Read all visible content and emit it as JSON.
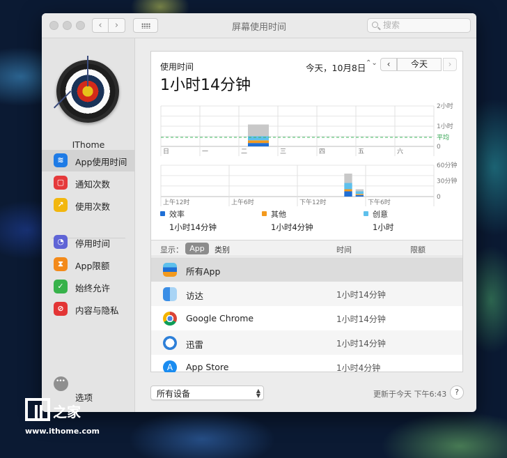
{
  "window": {
    "title": "屏幕使用时间",
    "search_placeholder": "搜索"
  },
  "sidebar": {
    "username": "IThome",
    "items": [
      {
        "label": "App使用时间",
        "icon": "layers-icon",
        "color": "#1e7be6",
        "active": true
      },
      {
        "label": "通知次数",
        "icon": "notification-icon",
        "color": "#e5393b"
      },
      {
        "label": "使用次数",
        "icon": "pickup-icon",
        "color": "#f2b70f"
      },
      {
        "label": "停用时间",
        "icon": "downtime-icon",
        "color": "#5f64d6"
      },
      {
        "label": "App限额",
        "icon": "hourglass-icon",
        "color": "#f38a1a"
      },
      {
        "label": "始终允许",
        "icon": "checkmark-icon",
        "color": "#37b24a"
      },
      {
        "label": "内容与隐私",
        "icon": "restriction-icon",
        "color": "#e33535"
      }
    ],
    "options_label": "选项"
  },
  "main": {
    "label": "使用时间",
    "total": "1小时14分钟",
    "date": "今天，10月8日",
    "today_button": "今天"
  },
  "chart_data": [
    {
      "type": "bar",
      "stacked": true,
      "categories": [
        "日",
        "一",
        "二",
        "三",
        "四",
        "五",
        "六"
      ],
      "y_tick_labels": [
        "2小时",
        "1小时",
        "0"
      ],
      "ylim": [
        0,
        120
      ],
      "average_label": "平均",
      "average_value": 27,
      "series": [
        {
          "name": "效率",
          "color": "#1f6fd6",
          "values": [
            0,
            0,
            10,
            0,
            0,
            0,
            0
          ]
        },
        {
          "name": "其他",
          "color": "#f39a1e",
          "values": [
            0,
            0,
            8,
            0,
            0,
            0,
            0
          ]
        },
        {
          "name": "创意",
          "color": "#5ec0ec",
          "values": [
            0,
            0,
            12,
            0,
            0,
            0,
            0
          ]
        },
        {
          "color": "#c8c8c8",
          "values": [
            0,
            0,
            35,
            0,
            0,
            0,
            0
          ]
        }
      ]
    },
    {
      "type": "bar",
      "stacked": true,
      "x_tick_labels": [
        "上午12时",
        "上午6时",
        "下午12时",
        "下午6时"
      ],
      "y_tick_labels": [
        "60分钟",
        "30分钟",
        "0"
      ],
      "ylim": [
        0,
        60
      ],
      "hours": [
        16,
        17
      ],
      "series": [
        {
          "name": "效率",
          "color": "#1f6fd6",
          "values": [
            10,
            3
          ]
        },
        {
          "name": "其他",
          "color": "#f39a1e",
          "values": [
            4,
            2
          ]
        },
        {
          "name": "创意",
          "color": "#5ec0ec",
          "values": [
            12,
            5
          ]
        },
        {
          "color": "#c8c8c8",
          "values": [
            18,
            4
          ]
        }
      ]
    }
  ],
  "legend": [
    {
      "name": "效率",
      "value": "1小时14分钟",
      "color": "#1f6fd6"
    },
    {
      "name": "其他",
      "value": "1小时4分钟",
      "color": "#f39a1e"
    },
    {
      "name": "创意",
      "value": "1小时",
      "color": "#5ec0ec"
    }
  ],
  "table": {
    "show_label": "显示：",
    "segment_app": "App",
    "segment_category": "类别",
    "col_time": "时间",
    "col_limit": "限额",
    "rows": [
      {
        "name": "所有App",
        "time": "",
        "icon": "stack-icon"
      },
      {
        "name": "访达",
        "time": "1小时14分钟",
        "icon": "finder-icon"
      },
      {
        "name": "Google Chrome",
        "time": "1小时14分钟",
        "icon": "chrome-icon"
      },
      {
        "name": "迅雷",
        "time": "1小时14分钟",
        "icon": "thunder-icon"
      },
      {
        "name": "App Store",
        "time": "1小时4分钟",
        "icon": "appstore-icon"
      }
    ]
  },
  "footer": {
    "device_select": "所有设备",
    "updated": "更新于今天 下午6:43",
    "help": "?"
  },
  "watermark": {
    "chars": "之家",
    "url": "www.ithome.com"
  }
}
